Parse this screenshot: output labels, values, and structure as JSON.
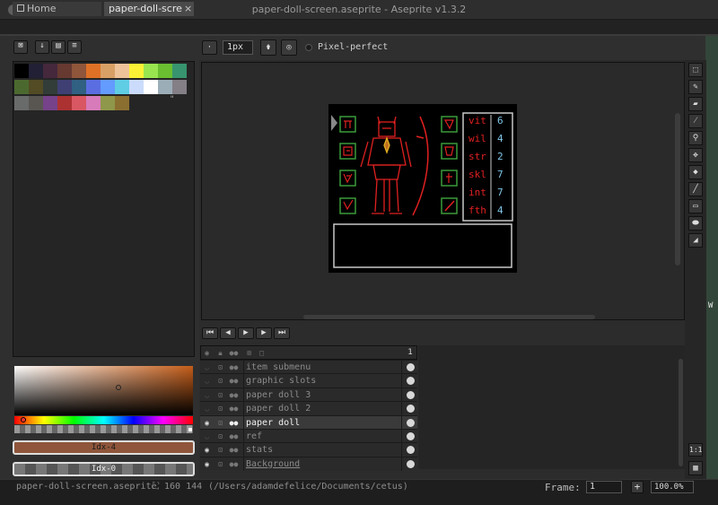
{
  "window": {
    "title": "paper-doll-screen.aseprite - Aseprite v1.3.2"
  },
  "tabs": [
    {
      "label": "Home",
      "active": false
    },
    {
      "label": "paper-doll-scre",
      "active": true,
      "close": "×"
    }
  ],
  "tool_options": {
    "brush_size": "1px",
    "pixel_perfect_label": "Pixel-perfect",
    "pixel_perfect_checked": false
  },
  "palette": {
    "colors": [
      "#000000",
      "#222034",
      "#45283c",
      "#663931",
      "#8f563b",
      "#df7126",
      "#d9a066",
      "#eec39a",
      "#fbf236",
      "#99e550",
      "#6abe30",
      "#37946e",
      "#4b692f",
      "#524b24",
      "#323c39",
      "#3f3f74",
      "#306082",
      "#5b6ee1",
      "#639bff",
      "#5fcde4",
      "#cbdbfc",
      "#ffffff",
      "#9badb7",
      "#847e87",
      "#696a6a",
      "#595652",
      "#76428a",
      "#ac3232",
      "#d95763",
      "#d77bba",
      "#8f974a",
      "#8a6f30"
    ],
    "more_icon": "\""
  },
  "color_bars": {
    "foreground_label": "Idx-4",
    "background_label": "Idx-0",
    "foreground_color": "#8f563b"
  },
  "sprite": {
    "stats": [
      {
        "label": "vit",
        "value": "6"
      },
      {
        "label": "wil",
        "value": "4"
      },
      {
        "label": "str",
        "value": "2"
      },
      {
        "label": "skl",
        "value": "7"
      },
      {
        "label": "int",
        "value": "7"
      },
      {
        "label": "fth",
        "value": "4"
      }
    ]
  },
  "timeline": {
    "frame_header": "1",
    "layers": [
      {
        "name": "item submenu",
        "visible": false,
        "active": false
      },
      {
        "name": "graphic slots",
        "visible": false,
        "active": false
      },
      {
        "name": "paper doll 3",
        "visible": false,
        "active": false
      },
      {
        "name": "paper doll 2",
        "visible": false,
        "active": false
      },
      {
        "name": "paper doll",
        "visible": true,
        "active": true
      },
      {
        "name": "ref",
        "visible": false,
        "active": false
      },
      {
        "name": "stats",
        "visible": true,
        "active": false
      },
      {
        "name": "Background",
        "visible": true,
        "active": false
      }
    ]
  },
  "statusbar": {
    "filename": "paper-doll-screen.aseprite",
    "size": "160 144",
    "path": "(/Users/adamdefelice/Documents/cetus)",
    "frame_label": "Frame:",
    "frame_value": "1",
    "add_frame": "+",
    "zoom": "100.0%"
  },
  "zoom_button": "1:1",
  "colors": {
    "accent_red": "#e02020",
    "accent_cyan": "#7fc6e6",
    "canvas_bg": "#000000"
  }
}
